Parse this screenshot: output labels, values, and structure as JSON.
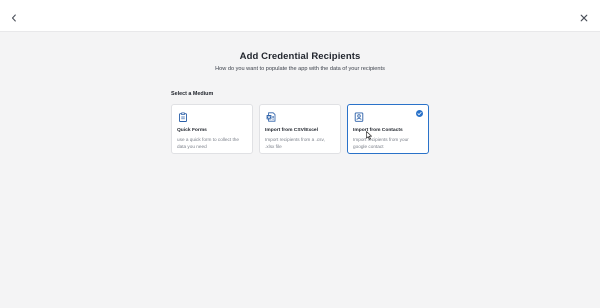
{
  "header": {
    "back_icon": "chevron-left-icon",
    "close_icon": "close-icon"
  },
  "page": {
    "title": "Add Credential Recipients",
    "subtitle": "How do you want to populate the app with the data of your recipients"
  },
  "medium": {
    "label": "Select a Medium",
    "options": [
      {
        "title": "Quick Forms",
        "description": "use a quick form to collect the data you need",
        "icon": "clipboard-icon",
        "selected": false
      },
      {
        "title": "Import from CSV/Excel",
        "description": "Import recipients from a .csv, .xlsx file",
        "icon": "excel-file-icon",
        "selected": false
      },
      {
        "title": "Import from Contacts",
        "description": "Import recipients from your google contact",
        "icon": "contacts-book-icon",
        "selected": true
      }
    ]
  },
  "colors": {
    "accent": "#2a72c9",
    "icon": "#2a5fa8",
    "background": "#f4f4f5"
  }
}
